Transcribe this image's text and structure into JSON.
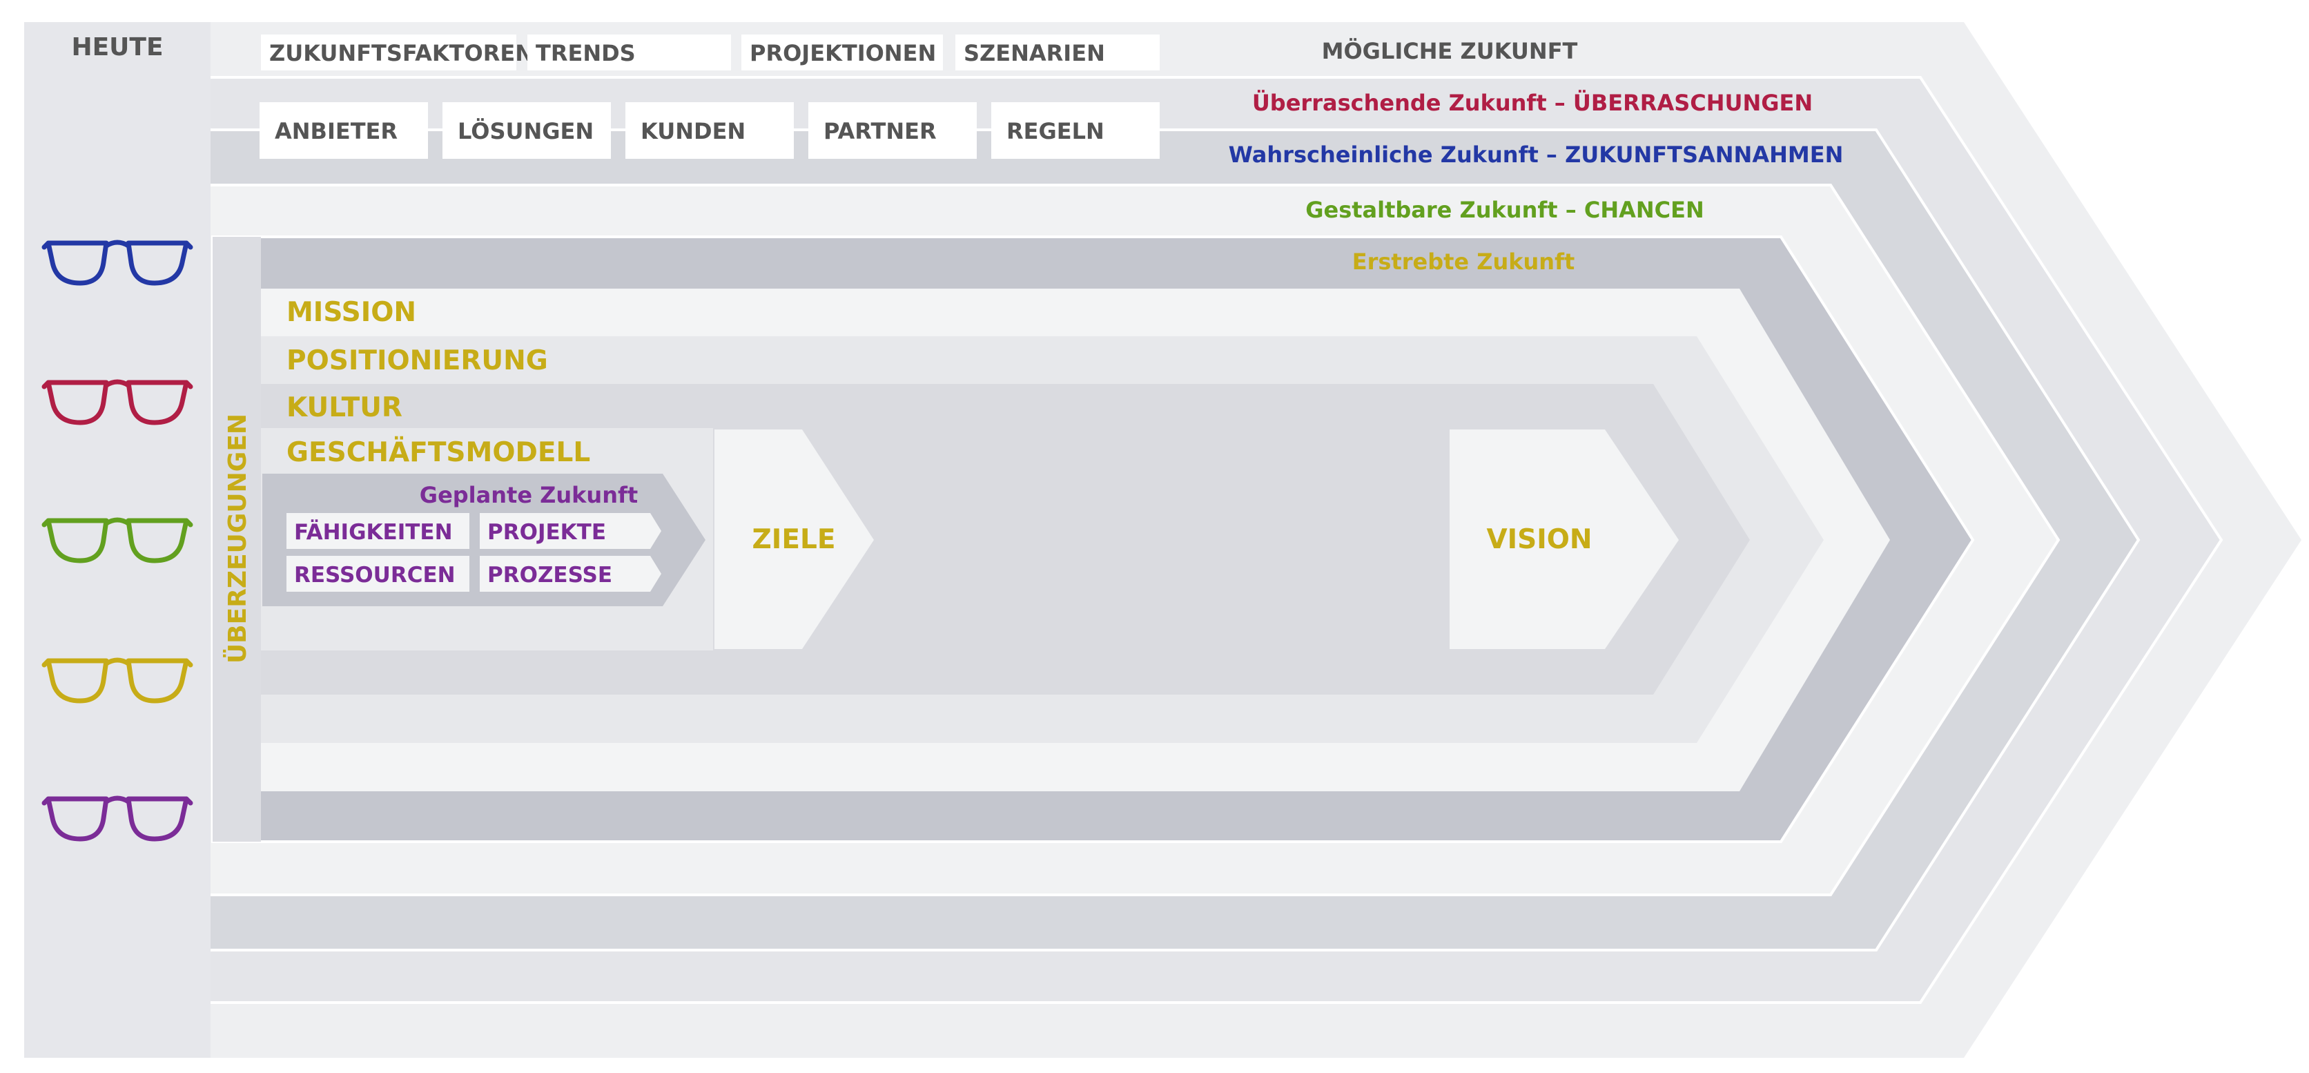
{
  "left_column": {
    "title": "HEUTE",
    "glasses": [
      {
        "icon": "glasses-icon",
        "color": "#2338A5"
      },
      {
        "icon": "glasses-icon",
        "color": "#B01E45"
      },
      {
        "icon": "glasses-icon",
        "color": "#62A01F"
      },
      {
        "icon": "glasses-icon",
        "color": "#C7AC17"
      },
      {
        "icon": "glasses-icon",
        "color": "#7B2C97"
      }
    ]
  },
  "top_boxes_row1": [
    "ZUKUNFTSFAKTOREN",
    "TRENDS",
    "PROJEKTIONEN",
    "SZENARIEN"
  ],
  "top_boxes_row2": [
    "ANBIETER",
    "LÖSUNGEN",
    "KUNDEN",
    "PARTNER",
    "REGELN"
  ],
  "layers": [
    {
      "label": "MÖGLICHE ZUKUNFT",
      "color": "#555555"
    },
    {
      "label": "Überraschende Zukunft – ÜBERRASCHUNGEN",
      "color": "#B01E45"
    },
    {
      "label": "Wahrscheinliche Zukunft – ZUKUNFTSANNAHMEN",
      "color": "#2338A5"
    },
    {
      "label": "Gestaltbare Zukunft – CHANCEN",
      "color": "#62A01F"
    },
    {
      "label": "Erstrebte Zukunft",
      "color": "#C7AC17"
    }
  ],
  "beliefs_label": "ÜBERZEUGUNGEN",
  "gold_rows": [
    "MISSION",
    "POSITIONIERUNG",
    "KULTUR",
    "GESCHÄFTSMODELL"
  ],
  "planned": {
    "title": "Geplante Zukunft",
    "items": [
      "FÄHIGKEITEN",
      "PROJEKTE",
      "RESSOURCEN",
      "PROZESSE"
    ]
  },
  "goals_label": "ZIELE",
  "vision_label": "VISION",
  "colors": {
    "gold": "#C7AC17",
    "purple": "#7B2C97",
    "dark_text": "#555555",
    "outer_band": "#EDEEF0",
    "heute_column": "#E6E7EB"
  }
}
